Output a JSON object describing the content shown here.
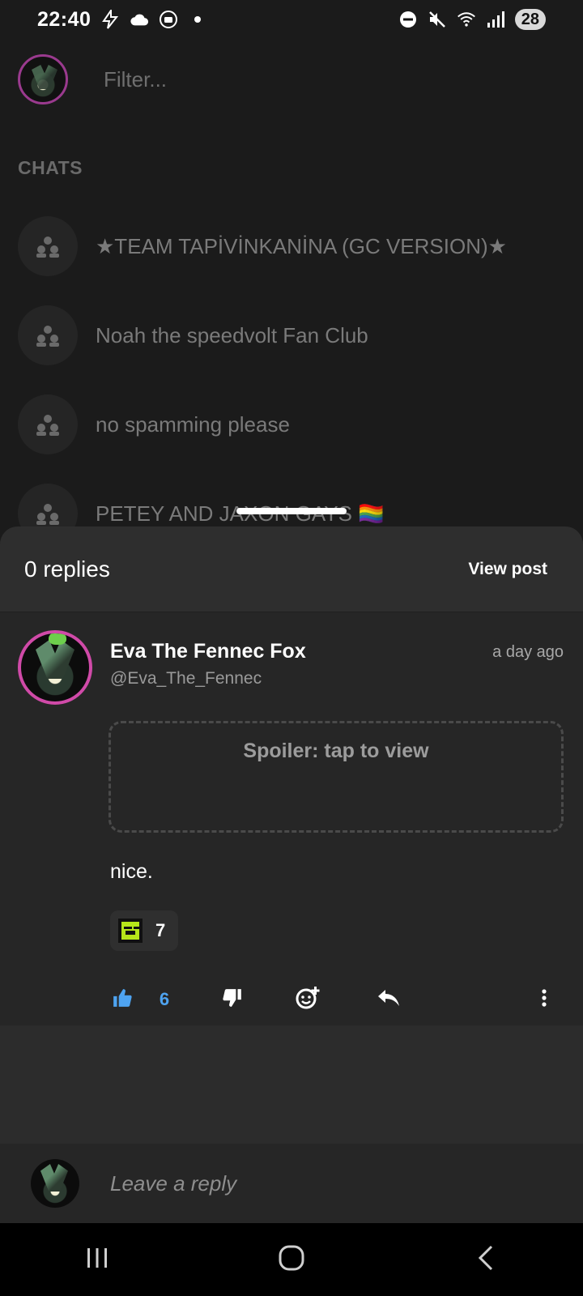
{
  "status_bar": {
    "time": "22:40",
    "battery": "28",
    "left_icons": [
      "bolt-icon",
      "cloud-icon",
      "vpn-icon",
      "dot-icon"
    ],
    "right_icons": [
      "dnd-icon",
      "mute-icon",
      "wifi-icon",
      "signal-icon"
    ]
  },
  "background_list": {
    "filter_placeholder": "Filter...",
    "section_label": "CHATS",
    "chats": [
      {
        "name": "★TEAM TAPİVİNKANİNA (GC VERSION)★"
      },
      {
        "name": "Noah the speedvolt Fan Club"
      },
      {
        "name": "no spamming please"
      },
      {
        "name": "PETEY AND JAXON GAYS 🏳️‍🌈"
      }
    ]
  },
  "sheet": {
    "replies_label": "0 replies",
    "view_post_label": "View post"
  },
  "comment": {
    "author_name": "Eva The Fennec Fox",
    "author_handle": "@Eva_The_Fennec",
    "timestamp": "a day ago",
    "spoiler_label": "Spoiler: tap to view",
    "text": "nice.",
    "reaction": {
      "emoji": "pixel-face-icon",
      "count": "7"
    },
    "like_count": "6"
  },
  "reply_bar": {
    "placeholder": "Leave a reply"
  },
  "colors": {
    "accent_blue": "#4ea3f0",
    "avatar_ring": "#d04aa8",
    "reaction_green": "#b6e61a"
  }
}
